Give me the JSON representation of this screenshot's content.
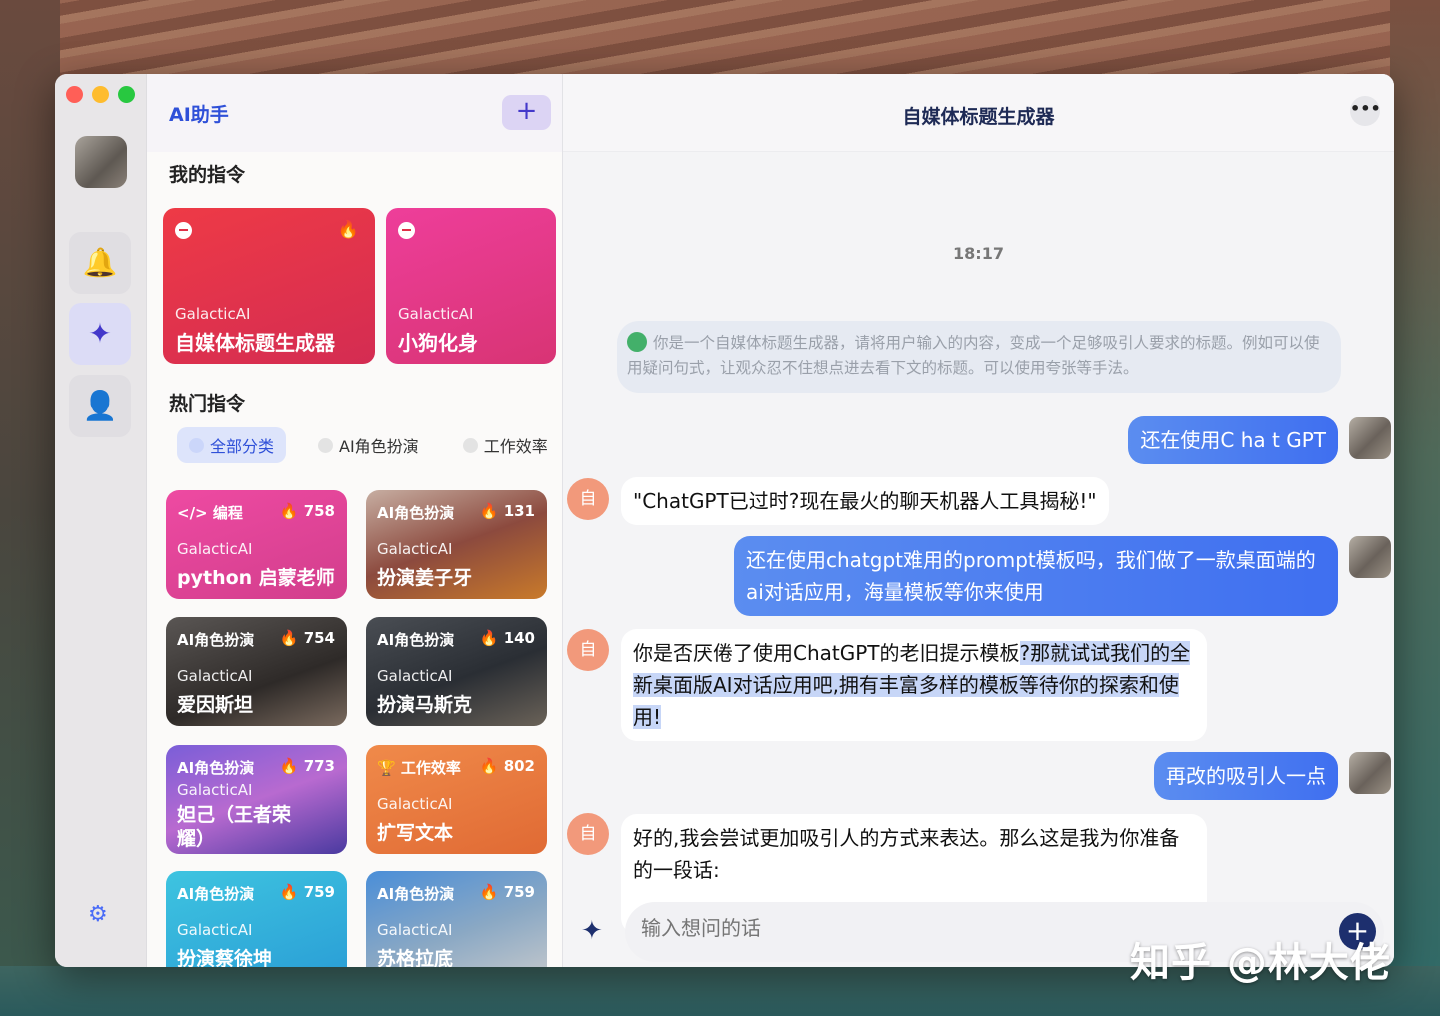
{
  "sidebar": {
    "title": "AI助手",
    "add_icon": "plus-icon",
    "my_commands_title": "我的指令",
    "hot_commands_title": "热门指令",
    "my_cards": [
      {
        "brand": "GalacticAI",
        "name": "自媒体标题生成器",
        "color": "#e42e44"
      },
      {
        "brand": "GalacticAI",
        "name": "小狗化身",
        "color": "#e03a8c"
      }
    ],
    "tabs": [
      "全部分类",
      "AI角色扮演",
      "工作效率"
    ],
    "cards": [
      {
        "tag": "</> 编程",
        "count": "758",
        "brand": "GalacticAI",
        "name": "python 启蒙老师"
      },
      {
        "tag": "AI角色扮演",
        "count": "131",
        "brand": "GalacticAI",
        "name": "扮演姜子牙"
      },
      {
        "tag": "AI角色扮演",
        "count": "754",
        "brand": "GalacticAI",
        "name": "爱因斯坦"
      },
      {
        "tag": "AI角色扮演",
        "count": "140",
        "brand": "GalacticAI",
        "name": "扮演马斯克"
      },
      {
        "tag": "AI角色扮演",
        "count": "773",
        "brand": "GalacticAI",
        "name": "妲己（王者荣耀）"
      },
      {
        "tag": "工作效率",
        "count": "802",
        "brand": "GalacticAI",
        "name": "扩写文本"
      },
      {
        "tag": "AI角色扮演",
        "count": "759",
        "brand": "GalacticAI",
        "name": "扮演蔡徐坤"
      },
      {
        "tag": "AI角色扮演",
        "count": "759",
        "brand": "GalacticAI",
        "name": "苏格拉底"
      }
    ]
  },
  "chat": {
    "title": "自媒体标题生成器",
    "time": "18:17",
    "system_prompt": "你是一个自媒体标题生成器，请将用户输入的内容，变成一个足够吸引人要求的标题。例如可以使用疑问句式，让观众忍不住想点进去看下文的标题。可以使用夸张等手法。",
    "ai_avatar_label": "自",
    "messages": [
      {
        "role": "user",
        "text": "还在使用C ha t GPT"
      },
      {
        "role": "ai",
        "text": "\"ChatGPT已过时?现在最火的聊天机器人工具揭秘!\""
      },
      {
        "role": "user",
        "text": "还在使用chatgpt难用的prompt模板吗，我们做了一款桌面端的ai对话应用，海量模板等你来使用"
      },
      {
        "role": "ai",
        "text_plain": "你是否厌倦了使用ChatGPT的老旧提示模板",
        "text_highlight": "?那就试试我们的全新桌面版AI对话应用吧,拥有丰富多样的模板等待你的探索和使用!"
      },
      {
        "role": "user",
        "text": "再改的吸引人一点"
      },
      {
        "role": "ai",
        "text": "好的,我会尝试更加吸引人的方式来表达。那么这是我为你准备的一段话:"
      }
    ],
    "input_placeholder": "输入想问的话"
  },
  "watermark": "知乎 @林大佬"
}
